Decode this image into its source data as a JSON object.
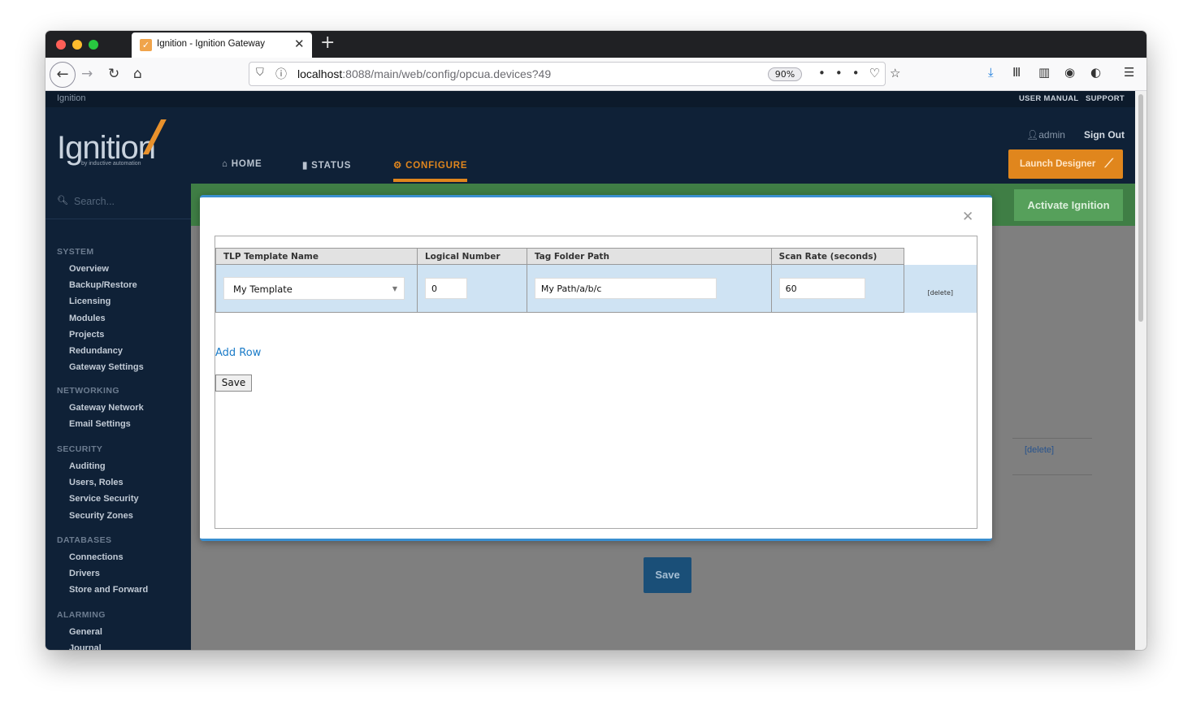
{
  "browser": {
    "tab_title": "Ignition - Ignition Gateway",
    "url_host": "localhost",
    "url_rest": ":8088/main/web/config/opcua.devices?49",
    "zoom": "90%"
  },
  "header": {
    "brand_small": "Ignition",
    "logo_text": "Ignition",
    "logo_sub": "by inductive automation",
    "user_manual": "USER MANUAL",
    "support": "SUPPORT",
    "username": "admin",
    "sign_out": "Sign Out",
    "launch_designer": "Launch Designer",
    "nav": {
      "home": "HOME",
      "status": "STATUS",
      "configure": "CONFIGURE"
    },
    "accent_color": "#e0861d"
  },
  "sidebar": {
    "search_placeholder": "Search...",
    "sections": [
      {
        "title": "SYSTEM",
        "items": [
          "Overview",
          "Backup/Restore",
          "Licensing",
          "Modules",
          "Projects",
          "Redundancy",
          "Gateway Settings"
        ]
      },
      {
        "title": "NETWORKING",
        "items": [
          "Gateway Network",
          "Email Settings"
        ]
      },
      {
        "title": "SECURITY",
        "items": [
          "Auditing",
          "Users, Roles",
          "Service Security",
          "Security Zones"
        ]
      },
      {
        "title": "DATABASES",
        "items": [
          "Connections",
          "Drivers",
          "Store and Forward"
        ]
      },
      {
        "title": "ALARMING",
        "items": [
          "General",
          "Journal"
        ]
      }
    ]
  },
  "background": {
    "activate": "Activate Ignition",
    "delete_link": "[delete]",
    "save": "Save"
  },
  "modal": {
    "columns": [
      "TLP Template Name",
      "Logical Number",
      "Tag Folder Path",
      "Scan Rate (seconds)"
    ],
    "row": {
      "template": "My Template",
      "logical_number": "0",
      "tag_folder_path": "My Path/a/b/c",
      "scan_rate": "60",
      "delete": "[delete]"
    },
    "add_row": "Add Row",
    "save": "Save"
  }
}
